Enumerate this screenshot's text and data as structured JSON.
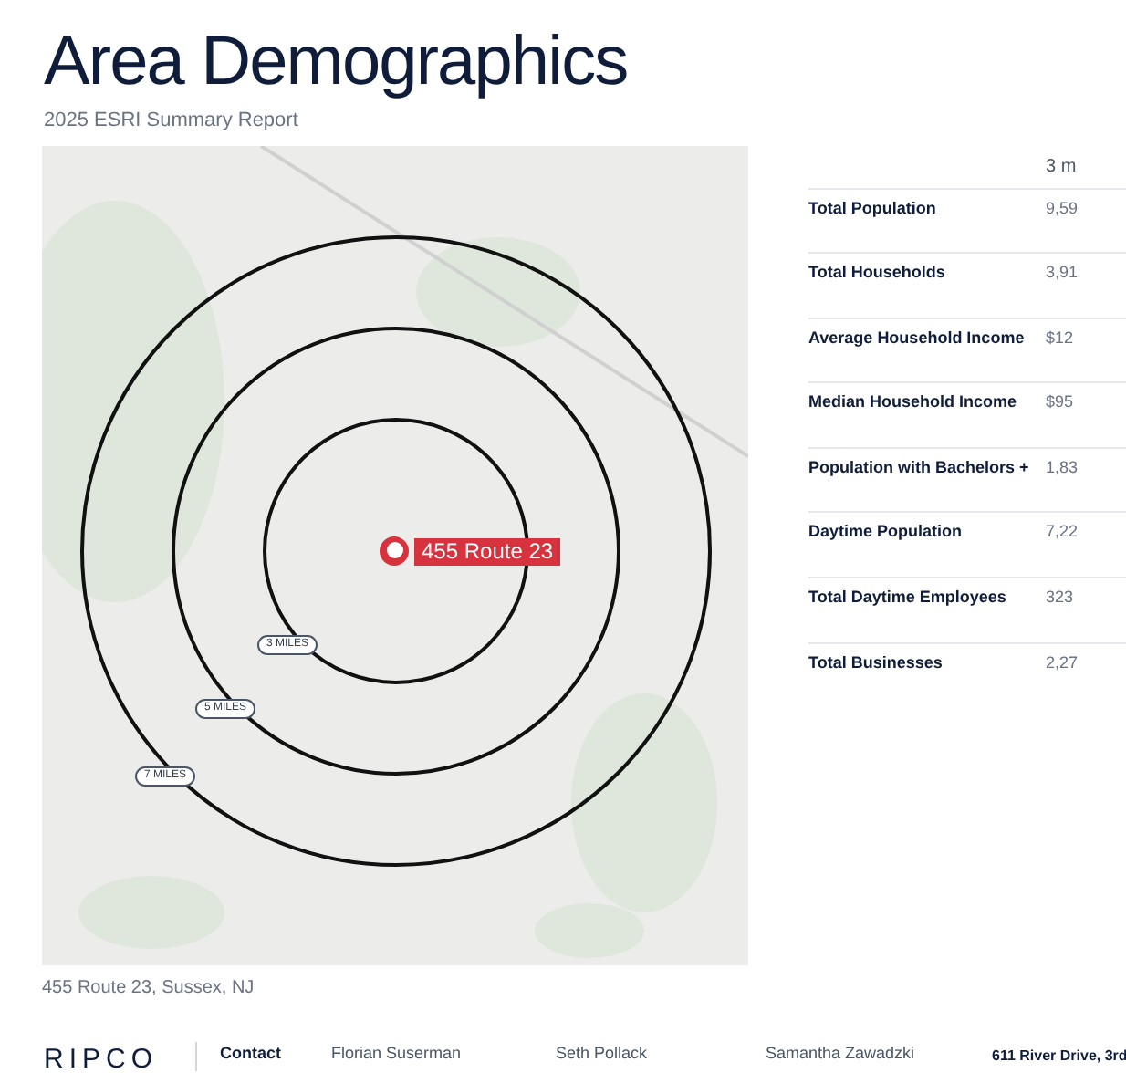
{
  "title": "Area Demographics",
  "subtitle": "2025 ESRI Summary Report",
  "map": {
    "pin_label": "455 Route 23",
    "rings": [
      {
        "label": "3 MILES"
      },
      {
        "label": "5 MILES"
      },
      {
        "label": "7 MILES"
      }
    ],
    "caption": "455 Route 23, Sussex, NJ"
  },
  "table": {
    "columns": [
      "3 m"
    ],
    "rows": [
      {
        "label": "Total Population",
        "values": [
          "9,59"
        ]
      },
      {
        "label": "Total Households",
        "values": [
          "3,91"
        ]
      },
      {
        "label": "Average Household Income",
        "values": [
          "$12"
        ]
      },
      {
        "label": "Median Household Income",
        "values": [
          "$95"
        ]
      },
      {
        "label": "Population with Bachelors +",
        "values": [
          "1,83"
        ]
      },
      {
        "label": "Daytime Population",
        "values": [
          "7,22"
        ]
      },
      {
        "label": "Total Daytime Employees",
        "values": [
          "323"
        ]
      },
      {
        "label": "Total Businesses",
        "values": [
          "2,27"
        ]
      }
    ]
  },
  "footer": {
    "logo": "RIPCO",
    "contact_heading": "Contact",
    "contacts": [
      "Florian Suserman",
      "Seth Pollack",
      "Samantha Zawadzki"
    ],
    "address": "611 River Drive, 3rd"
  }
}
